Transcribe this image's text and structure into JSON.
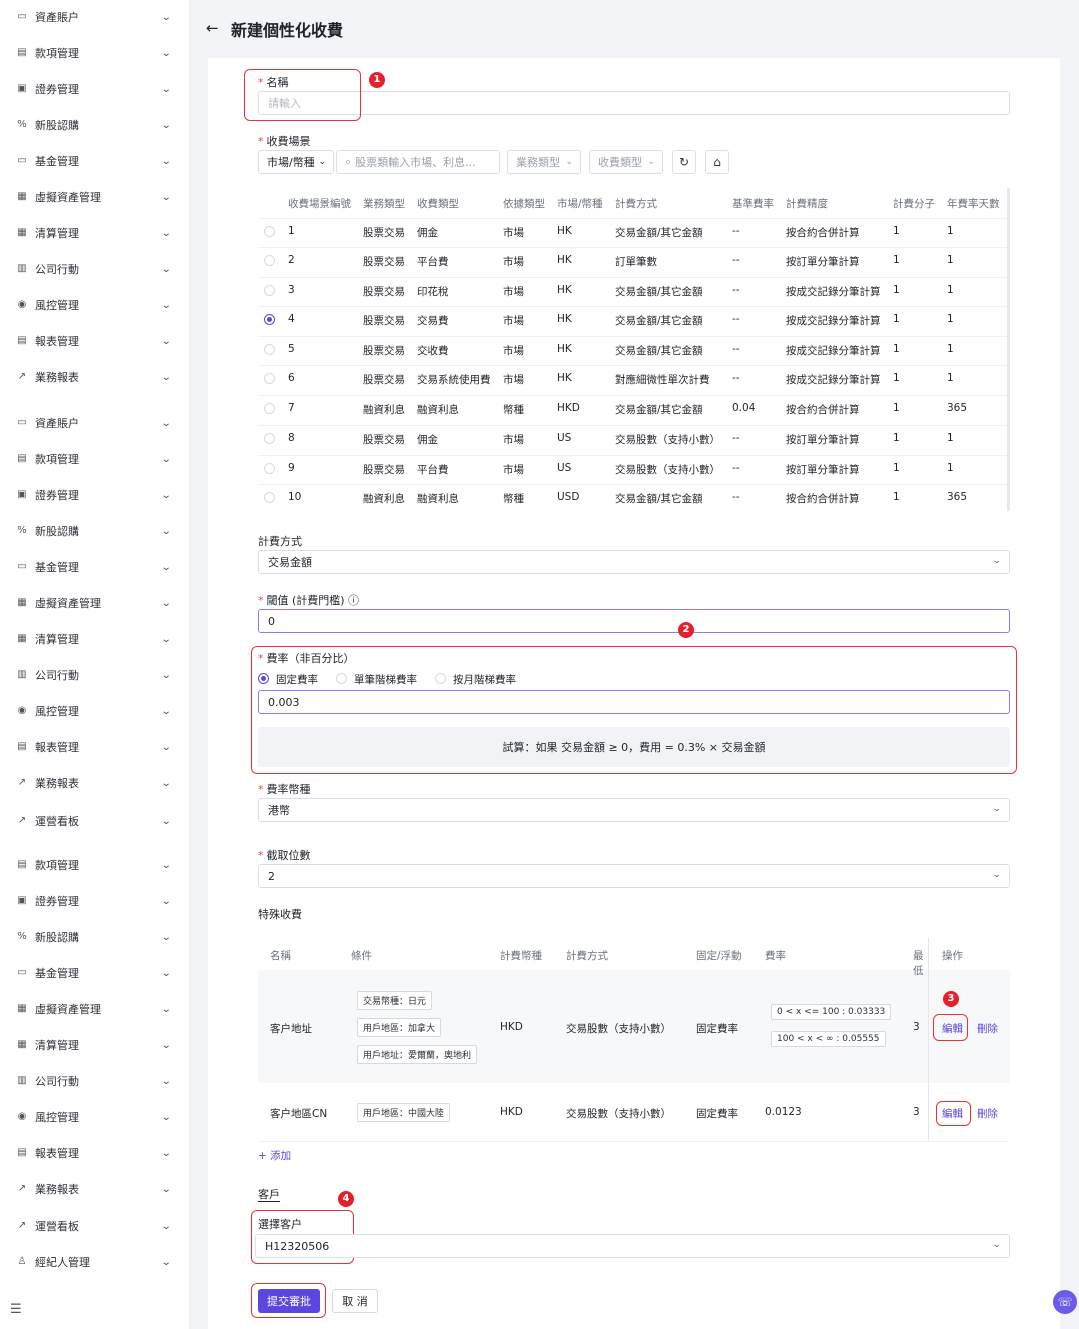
{
  "sidebar": {
    "items": [
      {
        "icon": "wallet-icon",
        "glyph": "▭",
        "label": "資產賬户"
      },
      {
        "icon": "ledger-icon",
        "glyph": "▤",
        "label": "款項管理"
      },
      {
        "icon": "securities-icon",
        "glyph": "▣",
        "label": "證券管理"
      },
      {
        "icon": "ipo-icon",
        "glyph": "%",
        "label": "新股認購"
      },
      {
        "icon": "fund-icon",
        "glyph": "▭",
        "label": "基金管理"
      },
      {
        "icon": "crypto-icon",
        "glyph": "▦",
        "label": "虛擬資產管理"
      },
      {
        "icon": "clearing-icon",
        "glyph": "▦",
        "label": "清算管理"
      },
      {
        "icon": "corporate-action-icon",
        "glyph": "▥",
        "label": "公司行動"
      },
      {
        "icon": "risk-icon",
        "glyph": "◉",
        "label": "風控管理"
      },
      {
        "icon": "report-icon",
        "glyph": "▤",
        "label": "報表管理"
      },
      {
        "icon": "chart-icon",
        "glyph": "↗",
        "label": "業務報表"
      },
      {
        "icon": "wallet-icon",
        "glyph": "▭",
        "label": "資產賬户"
      },
      {
        "icon": "ledger-icon",
        "glyph": "▤",
        "label": "款項管理"
      },
      {
        "icon": "securities-icon",
        "glyph": "▣",
        "label": "證券管理"
      },
      {
        "icon": "ipo-icon",
        "glyph": "%",
        "label": "新股認購"
      },
      {
        "icon": "fund-icon",
        "glyph": "▭",
        "label": "基金管理"
      },
      {
        "icon": "crypto-icon",
        "glyph": "▦",
        "label": "虛擬資產管理"
      },
      {
        "icon": "clearing-icon",
        "glyph": "▦",
        "label": "清算管理"
      },
      {
        "icon": "corporate-action-icon",
        "glyph": "▥",
        "label": "公司行動"
      },
      {
        "icon": "risk-icon",
        "glyph": "◉",
        "label": "風控管理"
      },
      {
        "icon": "report-icon",
        "glyph": "▤",
        "label": "報表管理"
      },
      {
        "icon": "chart-icon",
        "glyph": "↗",
        "label": "業務報表"
      },
      {
        "icon": "dashboard-icon",
        "glyph": "↗",
        "label": "運營看板"
      },
      {
        "icon": "ledger-icon",
        "glyph": "▤",
        "label": "款項管理"
      },
      {
        "icon": "securities-icon",
        "glyph": "▣",
        "label": "證券管理"
      },
      {
        "icon": "ipo-icon",
        "glyph": "%",
        "label": "新股認購"
      },
      {
        "icon": "fund-icon",
        "glyph": "▭",
        "label": "基金管理"
      },
      {
        "icon": "crypto-icon",
        "glyph": "▦",
        "label": "虛擬資產管理"
      },
      {
        "icon": "clearing-icon",
        "glyph": "▦",
        "label": "清算管理"
      },
      {
        "icon": "corporate-action-icon",
        "glyph": "▥",
        "label": "公司行動"
      },
      {
        "icon": "risk-icon",
        "glyph": "◉",
        "label": "風控管理"
      },
      {
        "icon": "report-icon",
        "glyph": "▤",
        "label": "報表管理"
      },
      {
        "icon": "chart-icon",
        "glyph": "↗",
        "label": "業務報表"
      },
      {
        "icon": "dashboard-icon",
        "glyph": "↗",
        "label": "運營看板"
      },
      {
        "icon": "broker-icon",
        "glyph": "♙",
        "label": "經紀人管理"
      }
    ]
  },
  "header": {
    "title": "新建個性化收費"
  },
  "form": {
    "name_label": "名稱",
    "name_placeholder": "請輸入",
    "scene_label": "收費場景",
    "filters": {
      "market": "市場/幣種",
      "search_placeholder": "股票類輸入市場、利息...",
      "business_type": "業務類型",
      "fee_type": "收費類型"
    },
    "scene_table": {
      "headers": [
        "收費場景編號",
        "業務類型",
        "收費類型",
        "依據類型",
        "市場/幣種",
        "計費方式",
        "基準費率",
        "計費精度",
        "計費分子",
        "年費率天數"
      ],
      "rows": [
        [
          "1",
          "股票交易",
          "佣金",
          "市場",
          "HK",
          "交易金額/其它金額",
          "--",
          "按合約合併計算",
          "1",
          "1"
        ],
        [
          "2",
          "股票交易",
          "平台費",
          "市場",
          "HK",
          "訂單筆數",
          "--",
          "按訂單分筆計算",
          "1",
          "1"
        ],
        [
          "3",
          "股票交易",
          "印花稅",
          "市場",
          "HK",
          "交易金額/其它金額",
          "--",
          "按成交記錄分筆計算",
          "1",
          "1"
        ],
        [
          "4",
          "股票交易",
          "交易費",
          "市場",
          "HK",
          "交易金額/其它金額",
          "--",
          "按成交記錄分筆計算",
          "1",
          "1"
        ],
        [
          "5",
          "股票交易",
          "交收費",
          "市場",
          "HK",
          "交易金額/其它金額",
          "--",
          "按成交記錄分筆計算",
          "1",
          "1"
        ],
        [
          "6",
          "股票交易",
          "交易系統使用費",
          "市場",
          "HK",
          "對應細微性單次計費",
          "--",
          "按成交記錄分筆計算",
          "1",
          "1"
        ],
        [
          "7",
          "融資利息",
          "融資利息",
          "幣種",
          "HKD",
          "交易金額/其它金額",
          "0.04",
          "按合約合併計算",
          "1",
          "365"
        ],
        [
          "8",
          "股票交易",
          "佣金",
          "市場",
          "US",
          "交易股數（支持小數）",
          "--",
          "按訂單分筆計算",
          "1",
          "1"
        ],
        [
          "9",
          "股票交易",
          "平台費",
          "市場",
          "US",
          "交易股數（支持小數）",
          "--",
          "按訂單分筆計算",
          "1",
          "1"
        ],
        [
          "10",
          "融資利息",
          "融資利息",
          "幣種",
          "USD",
          "交易金額/其它金額",
          "--",
          "按合約合併計算",
          "1",
          "365"
        ]
      ],
      "selected_row": 3
    },
    "billing_method_label": "計費方式",
    "billing_method_value": "交易金額",
    "threshold_label": "閾值 (計費門檻)",
    "threshold_value": "0",
    "rate_label": "費率（非百分比）",
    "rate_options": [
      "固定費率",
      "單筆階梯費率",
      "按月階梯費率"
    ],
    "rate_selected": 0,
    "rate_value": "0.003",
    "rate_hint": "試算：如果 交易金額 ≥ 0，費用 = 0.3% × 交易金額",
    "rate_currency_label": "費率幣種",
    "rate_currency_value": "港幣",
    "decimals_label": "截取位數",
    "decimals_value": "2",
    "special_label": "特殊收費",
    "special_table": {
      "headers": [
        "名稱",
        "條件",
        "計費幣種",
        "計費方式",
        "固定/浮動",
        "費率",
        "最低",
        "操作"
      ],
      "rows": [
        {
          "name": "客户地址",
          "conditions": [
            "交易幣種：日元",
            "用戶地區：加拿大",
            "用戶地址：愛爾蘭，奧地利"
          ],
          "currency": "HKD",
          "method": "交易股數（支持小數）",
          "type": "固定費率",
          "rates": [
            "0 < x <= 100 : 0.03333",
            "100 < x < ∞ : 0.05555"
          ],
          "min": "3",
          "edit": "編輯",
          "delete": "刪除"
        },
        {
          "name": "客户地區CN",
          "conditions": [
            "用戶地區：中國大陸"
          ],
          "currency": "HKD",
          "method": "交易股數（支持小數）",
          "type": "固定費率",
          "rate": "0.0123",
          "min": "3",
          "edit": "編輯",
          "delete": "刪除"
        }
      ]
    },
    "add_label": "+ 添加",
    "customer_section": "客戶",
    "customer_label": "選擇客户",
    "customer_value": "H12320506",
    "submit_label": "提交審批",
    "cancel_label": "取 消"
  },
  "annotations": [
    "1",
    "2",
    "3",
    "4"
  ],
  "colors": {
    "accent": "#5b47e0",
    "annotation_red": "#e5333a"
  }
}
